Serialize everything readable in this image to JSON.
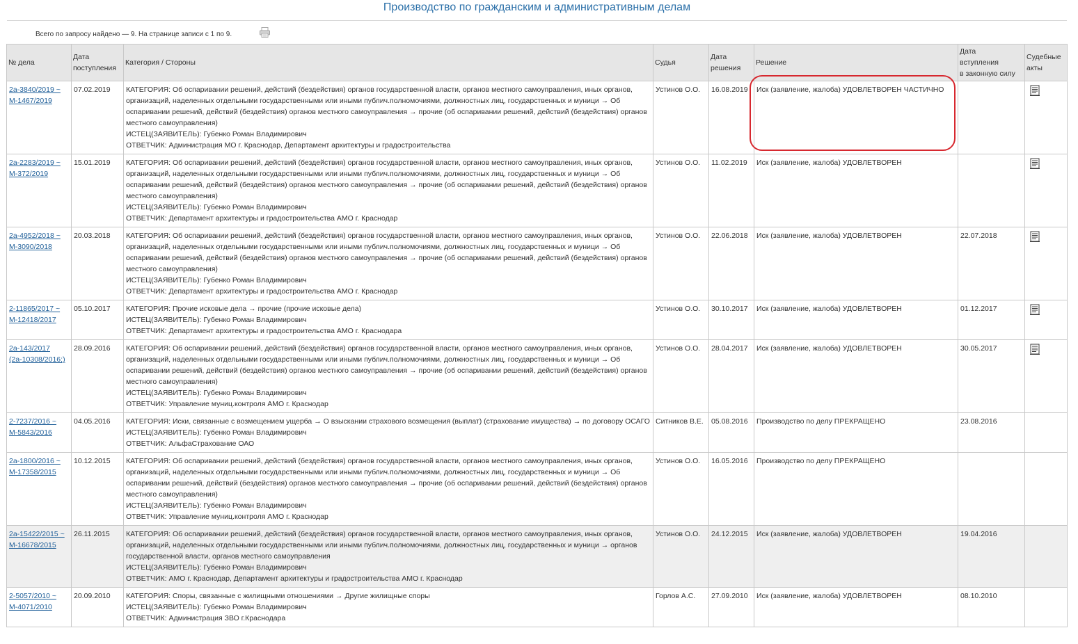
{
  "page": {
    "title": "Производство по гражданским и административным делам",
    "summary": "Всего по запросу найдено — 9. На странице записи с 1 по 9.",
    "print_icon": "printer-icon",
    "doc_icon": "document-icon",
    "highlight_color": "#d7282f",
    "link_color": "#1f5f99"
  },
  "table": {
    "headers": {
      "case_no": "№ дела",
      "date_received_1": "Дата",
      "date_received_2": "поступления",
      "category": "Категория / Стороны",
      "judge": "Судья",
      "decision_date_1": "Дата",
      "decision_date_2": "решения",
      "decision": "Решение",
      "effective_1": "Дата",
      "effective_2": "вступления",
      "effective_3": "в законную силу",
      "acts_1": "Судебные",
      "acts_2": "акты"
    },
    "rows": [
      {
        "case_line1": "2а-3840/2019 ~",
        "case_line2": "М-1467/2019",
        "received": "07.02.2019",
        "category": "КАТЕГОРИЯ: Об оспаривании решений, действий (бездействия) органов государственной власти, органов местного самоуправления, иных органов, организаций, наделенных отдельными государственными или иными публич.полномочиями, должностных лиц, государственных и муници → Об оспаривании решений, действий (бездействия) органов местного самоуправления → прочие (об оспаривании решений, действий (бездействия) органов местного самоуправления)",
        "plaintiff": "ИСТЕЦ(ЗАЯВИТЕЛЬ): Губенко Роман Владимирович",
        "defendant": "ОТВЕТЧИК: Администрация МО г. Краснодар, Департамент архитектуры и градостроительства",
        "judge": "Устинов О.О.",
        "decision_date": "16.08.2019",
        "decision": "Иск (заявление, жалоба) УДОВЛЕТВОРЕН ЧАСТИЧНО",
        "effective": "",
        "has_act": true
      },
      {
        "case_line1": "2а-2283/2019 ~",
        "case_line2": "М-372/2019",
        "received": "15.01.2019",
        "category": "КАТЕГОРИЯ: Об оспаривании решений, действий (бездействия) органов государственной власти, органов местного самоуправления, иных органов, организаций, наделенных отдельными государственными или иными публич.полномочиями, должностных лиц, государственных и муници → Об оспаривании решений, действий (бездействия) органов местного самоуправления → прочие (об оспаривании решений, действий (бездействия) органов местного самоуправления)",
        "plaintiff": "ИСТЕЦ(ЗАЯВИТЕЛЬ): Губенко Роман Владимирович",
        "defendant": "ОТВЕТЧИК: Департамент архитектуры и градостроительства АМО г. Краснодар",
        "judge": "Устинов О.О.",
        "decision_date": "11.02.2019",
        "decision": "Иск (заявление, жалоба) УДОВЛЕТВОРЕН",
        "effective": "",
        "has_act": true
      },
      {
        "case_line1": "2а-4952/2018 ~",
        "case_line2": "М-3090/2018",
        "received": "20.03.2018",
        "category": "КАТЕГОРИЯ: Об оспаривании решений, действий (бездействия) органов государственной власти, органов местного самоуправления, иных органов, организаций, наделенных отдельными государственными или иными публич.полномочиями, должностных лиц, государственных и муници → Об оспаривании решений, действий (бездействия) органов местного самоуправления → прочие (об оспаривании решений, действий (бездействия) органов местного самоуправления)",
        "plaintiff": "ИСТЕЦ(ЗАЯВИТЕЛЬ): Губенко Роман Владимирович",
        "defendant": "ОТВЕТЧИК: Департамент архитектуры и градостроительства АМО г. Краснодар",
        "judge": "Устинов О.О.",
        "decision_date": "22.06.2018",
        "decision": "Иск (заявление, жалоба) УДОВЛЕТВОРЕН",
        "effective": "22.07.2018",
        "has_act": true
      },
      {
        "case_line1": "2-11865/2017 ~",
        "case_line2": "М-12418/2017",
        "received": "05.10.2017",
        "category": "КАТЕГОРИЯ: Прочие исковые дела → прочие (прочие исковые дела)",
        "plaintiff": "ИСТЕЦ(ЗАЯВИТЕЛЬ): Губенко Роман Владимирович",
        "defendant": "ОТВЕТЧИК: Департамент архитектуры и градостроительства АМО г. Краснодара",
        "judge": "Устинов О.О.",
        "decision_date": "30.10.2017",
        "decision": "Иск (заявление, жалоба) УДОВЛЕТВОРЕН",
        "effective": "01.12.2017",
        "has_act": true
      },
      {
        "case_line1": "2а-143/2017",
        "case_line2": "(2а-10308/2016;)",
        "received": "28.09.2016",
        "category": "КАТЕГОРИЯ: Об оспаривании решений, действий (бездействия) органов государственной власти, органов местного самоуправления, иных органов, организаций, наделенных отдельными государственными или иными публич.полномочиями, должностных лиц, государственных и муници → Об оспаривании решений, действий (бездействия) органов местного самоуправления → прочие (об оспаривании решений, действий (бездействия) органов местного самоуправления)",
        "plaintiff": "ИСТЕЦ(ЗАЯВИТЕЛЬ): Губенко Роман Владимирович",
        "defendant": "ОТВЕТЧИК: Управление муниц.контроля АМО г. Краснодар",
        "judge": "Устинов О.О.",
        "decision_date": "28.04.2017",
        "decision": "Иск (заявление, жалоба) УДОВЛЕТВОРЕН",
        "effective": "30.05.2017",
        "has_act": true
      },
      {
        "case_line1": "2-7237/2016 ~",
        "case_line2": "М-5843/2016",
        "received": "04.05.2016",
        "category": "КАТЕГОРИЯ: Иски, связанные с возмещением ущерба → О взыскании страхового возмещения (выплат) (страхование имущества) → по договору ОСАГО",
        "plaintiff": "ИСТЕЦ(ЗАЯВИТЕЛЬ): Губенко Роман Владимирович",
        "defendant": "ОТВЕТЧИК: АльфаСтрахование ОАО",
        "judge": "Ситников В.Е.",
        "decision_date": "05.08.2016",
        "decision": "Производство по делу ПРЕКРАЩЕНО",
        "effective": "23.08.2016",
        "has_act": false
      },
      {
        "case_line1": "2а-1800/2016 ~",
        "case_line2": "М-17358/2015",
        "received": "10.12.2015",
        "category": "КАТЕГОРИЯ: Об оспаривании решений, действий (бездействия) органов государственной власти, органов местного самоуправления, иных органов, организаций, наделенных отдельными государственными или иными публич.полномочиями, должностных лиц, государственных и муници → Об оспаривании решений, действий (бездействия) органов местного самоуправления → прочие (об оспаривании решений, действий (бездействия) органов местного самоуправления)",
        "plaintiff": "ИСТЕЦ(ЗАЯВИТЕЛЬ): Губенко Роман Владимирович",
        "defendant": "ОТВЕТЧИК: Управление муниц.контроля АМО г. Краснодар",
        "judge": "Устинов О.О.",
        "decision_date": "16.05.2016",
        "decision": "Производство по делу ПРЕКРАЩЕНО",
        "effective": "",
        "has_act": false
      },
      {
        "case_line1": "2а-15422/2015 ~",
        "case_line2": "М-16678/2015",
        "received": "26.11.2015",
        "category": "КАТЕГОРИЯ: Об оспаривании решений, действий (бездействия) органов государственной власти, органов местного самоуправления, иных органов, организаций, наделенных отдельными государственными или иными публич.полномочиями, должностных лиц, государственных и муници → органов государственной власти, органов местного самоуправления",
        "plaintiff": "ИСТЕЦ(ЗАЯВИТЕЛЬ): Губенко Роман Владимирович",
        "defendant": "ОТВЕТЧИК: АМО г. Краснодар, Департамент архитектуры и градостроительства АМО г. Краснодар",
        "judge": "Устинов О.О.",
        "decision_date": "24.12.2015",
        "decision": "Иск (заявление, жалоба) УДОВЛЕТВОРЕН",
        "effective": "19.04.2016",
        "has_act": false
      },
      {
        "case_line1": "2-5057/2010 ~",
        "case_line2": "М-4071/2010",
        "received": "20.09.2010",
        "category": "КАТЕГОРИЯ: Споры, связанные с жилищными отношениями → Другие жилищные споры",
        "plaintiff": "ИСТЕЦ(ЗАЯВИТЕЛЬ): Губенко Роман Владимирович",
        "defendant": "ОТВЕТЧИК: Администрация ЗВО г.Краснодара",
        "judge": "Горлов А.С.",
        "decision_date": "27.09.2010",
        "decision": "Иск (заявление, жалоба) УДОВЛЕТВОРЕН",
        "effective": "08.10.2010",
        "has_act": false
      }
    ]
  }
}
